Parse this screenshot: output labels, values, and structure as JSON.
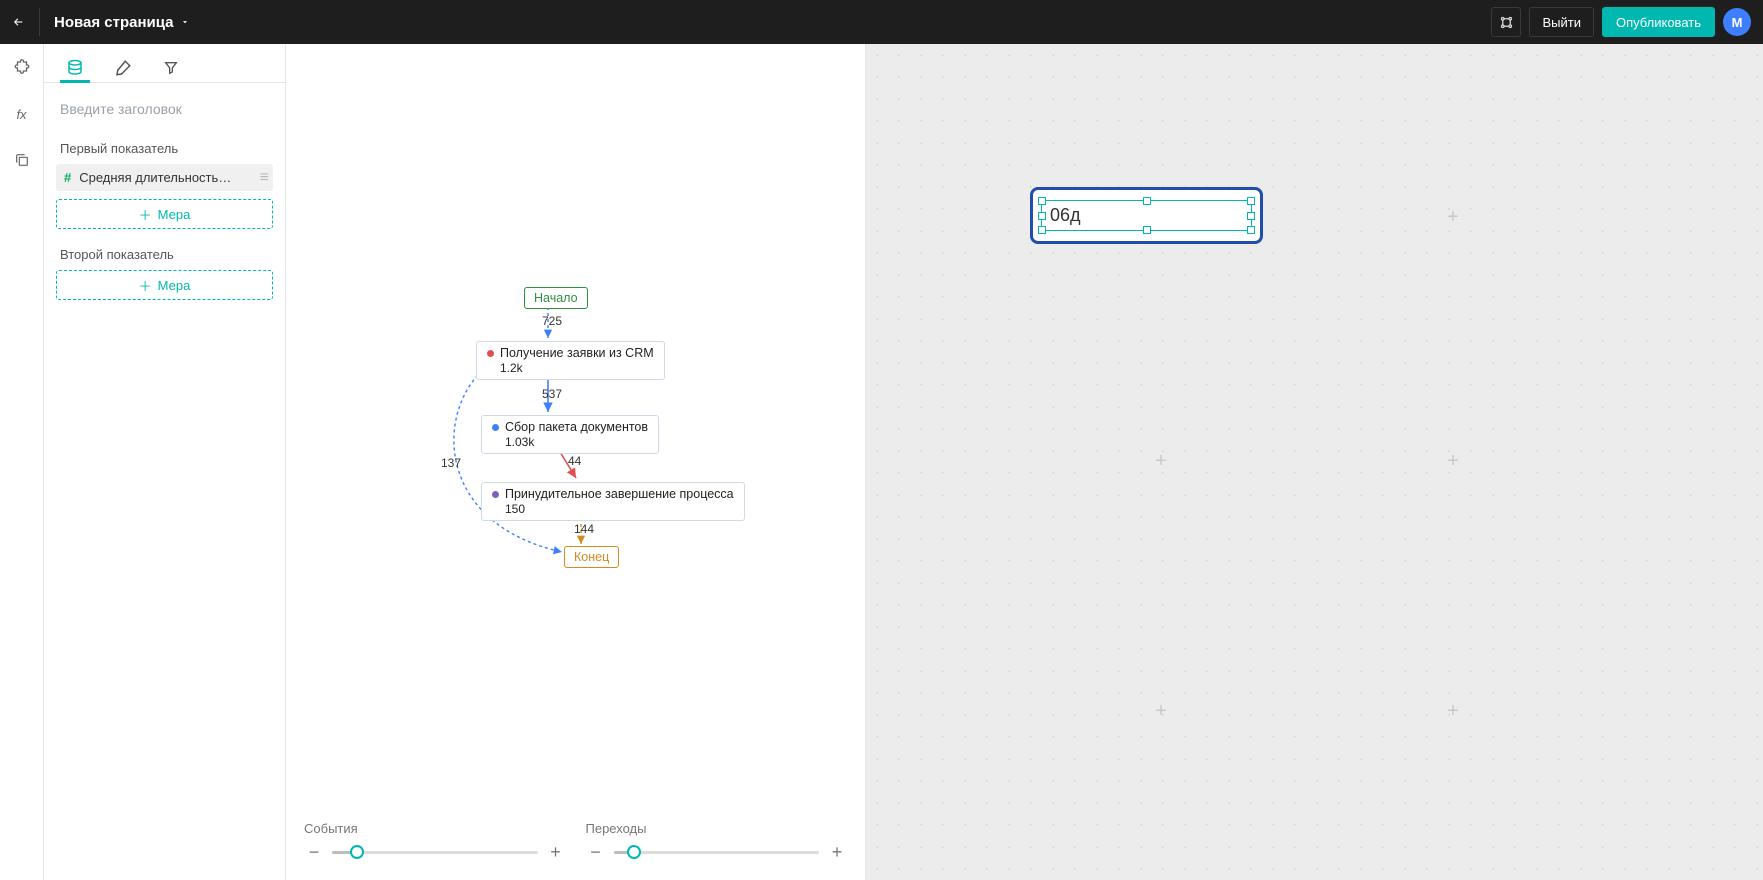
{
  "header": {
    "page_title": "Новая страница",
    "exit_label": "Выйти",
    "publish_label": "Опубликовать",
    "avatar_letter": "М"
  },
  "side": {
    "title_placeholder": "Введите заголовок",
    "section1_label": "Первый показатель",
    "metric1_name": "Средняя длительность обр...",
    "add_measure_label": "Мера",
    "section2_label": "Второй показатель"
  },
  "process": {
    "start_label": "Начало",
    "end_label": "Конец",
    "edge_start_to_n1": "725",
    "n1_title": "Получение заявки из CRM",
    "n1_value": "1.2k",
    "edge_n1_to_n2": "537",
    "n2_title": "Сбор пакета документов",
    "n2_value": "1.03k",
    "edge_n2_to_n3": "44",
    "n3_title": "Принудительное завершение процесса",
    "n3_value": "150",
    "edge_n3_to_end": "144",
    "edge_n1_to_end": "137"
  },
  "sliders": {
    "events_label": "События",
    "transitions_label": "Переходы"
  },
  "canvas": {
    "widget_value": "06д"
  }
}
